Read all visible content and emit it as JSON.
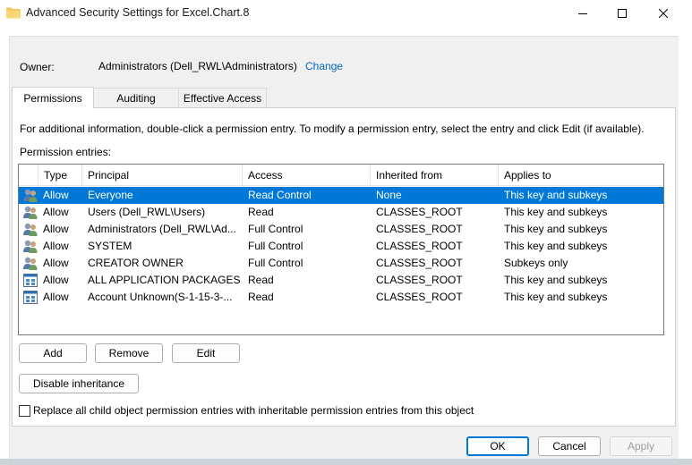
{
  "window": {
    "title": "Advanced Security Settings for Excel.Chart.8",
    "minimize_icon": "minimize-icon",
    "maximize_icon": "maximize-icon",
    "close_icon": "close-icon"
  },
  "owner": {
    "label": "Owner:",
    "value": "Administrators (Dell_RWL\\Administrators)",
    "change_link": "Change"
  },
  "tabs": [
    {
      "label": "Permissions",
      "active": true
    },
    {
      "label": "Auditing",
      "active": false
    },
    {
      "label": "Effective Access",
      "active": false
    }
  ],
  "permissions": {
    "info_text": "For additional information, double-click a permission entry. To modify a permission entry, select the entry and click Edit (if available).",
    "entries_label": "Permission entries:",
    "columns": [
      "Type",
      "Principal",
      "Access",
      "Inherited from",
      "Applies to"
    ],
    "rows": [
      {
        "icon": "users-icon",
        "type": "Allow",
        "principal": "Everyone",
        "access": "Read Control",
        "inherited": "None",
        "applies": "This key and subkeys",
        "selected": true
      },
      {
        "icon": "users-icon",
        "type": "Allow",
        "principal": "Users (Dell_RWL\\Users)",
        "access": "Read",
        "inherited": "CLASSES_ROOT",
        "applies": "This key and subkeys"
      },
      {
        "icon": "users-icon",
        "type": "Allow",
        "principal": "Administrators (Dell_RWL\\Ad...",
        "access": "Full Control",
        "inherited": "CLASSES_ROOT",
        "applies": "This key and subkeys"
      },
      {
        "icon": "users-icon",
        "type": "Allow",
        "principal": "SYSTEM",
        "access": "Full Control",
        "inherited": "CLASSES_ROOT",
        "applies": "This key and subkeys"
      },
      {
        "icon": "users-icon",
        "type": "Allow",
        "principal": "CREATOR OWNER",
        "access": "Full Control",
        "inherited": "CLASSES_ROOT",
        "applies": "Subkeys only"
      },
      {
        "icon": "app-package-icon",
        "type": "Allow",
        "principal": "ALL APPLICATION PACKAGES",
        "access": "Read",
        "inherited": "CLASSES_ROOT",
        "applies": "This key and subkeys"
      },
      {
        "icon": "app-package-icon",
        "type": "Allow",
        "principal": "Account Unknown(S-1-15-3-...",
        "access": "Read",
        "inherited": "CLASSES_ROOT",
        "applies": "This key and subkeys"
      }
    ],
    "buttons": {
      "add": "Add",
      "remove": "Remove",
      "edit": "Edit",
      "disable_inheritance": "Disable inheritance"
    },
    "replace_checkbox": {
      "label": "Replace all child object permission entries with inheritable permission entries from this object",
      "checked": false
    }
  },
  "footer": {
    "ok": "OK",
    "cancel": "Cancel",
    "apply": "Apply",
    "apply_enabled": false
  },
  "colors": {
    "selection": "#0078d7",
    "link": "#0067c0",
    "folder": "#f2c55c"
  }
}
